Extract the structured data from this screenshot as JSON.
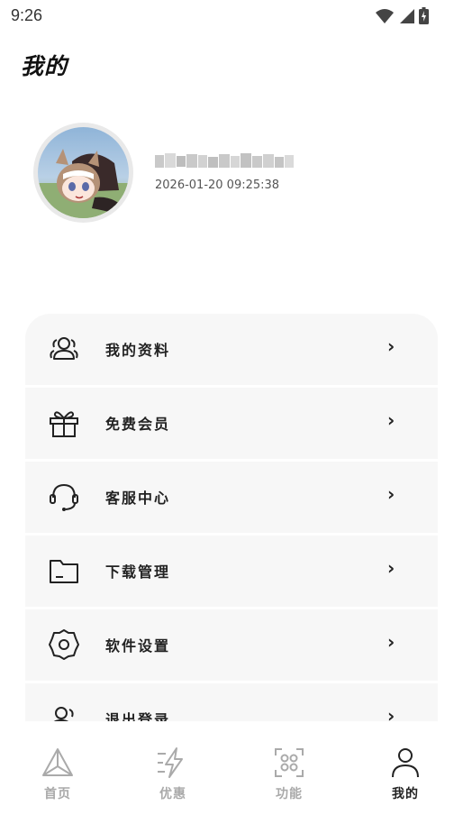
{
  "status_bar": {
    "time": "9:26",
    "icons": [
      "wifi-icon",
      "signal-icon",
      "battery-icon"
    ]
  },
  "page": {
    "title": "我的"
  },
  "profile": {
    "username": "████████████",
    "timestamp": "2026-01-20 09:25:38"
  },
  "menu": {
    "items": [
      {
        "label": "我的资料",
        "icon": "users-icon"
      },
      {
        "label": "免费会员",
        "icon": "gift-icon"
      },
      {
        "label": "客服中心",
        "icon": "headset-icon"
      },
      {
        "label": "下载管理",
        "icon": "folder-icon"
      },
      {
        "label": "软件设置",
        "icon": "settings-gear-icon"
      },
      {
        "label": "退出登录",
        "icon": "logout-user-icon"
      }
    ],
    "chevron": "›"
  },
  "bottom_nav": {
    "items": [
      {
        "label": "首页",
        "icon": "triangle-home-icon",
        "active": false
      },
      {
        "label": "优惠",
        "icon": "lightning-icon",
        "active": false
      },
      {
        "label": "功能",
        "icon": "grid-scan-icon",
        "active": false
      },
      {
        "label": "我的",
        "icon": "person-icon",
        "active": true
      }
    ]
  },
  "colors": {
    "menu_bg": "#f7f7f7",
    "active_nav": "#222222",
    "inactive_nav": "#a9a9a9"
  }
}
